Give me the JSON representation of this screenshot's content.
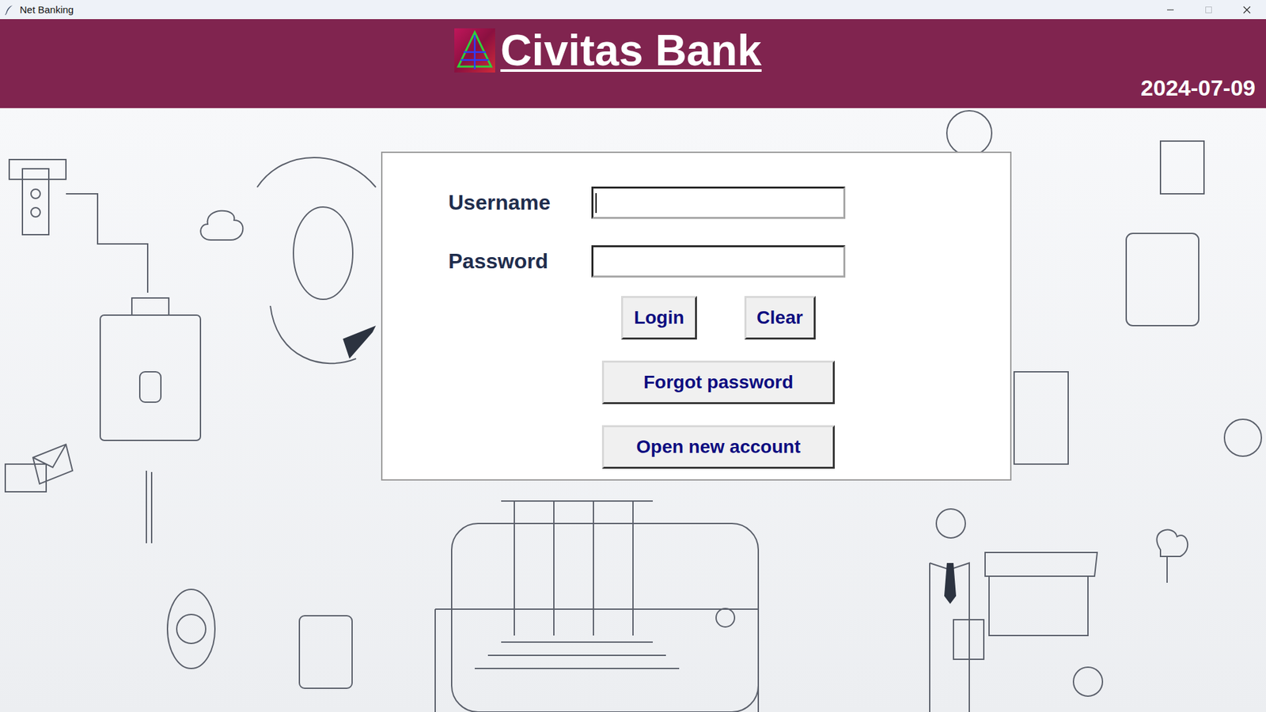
{
  "window": {
    "title": "Net Banking",
    "controls": [
      {
        "name": "minimize",
        "disabled": false
      },
      {
        "name": "maximize",
        "disabled": true
      },
      {
        "name": "close",
        "disabled": false
      }
    ]
  },
  "header": {
    "title": "Civitas Bank",
    "date": "2024-07-09"
  },
  "form": {
    "fields": [
      {
        "label": "Username",
        "value": "",
        "kind": "text",
        "focused": true
      },
      {
        "label": "Password",
        "value": "",
        "kind": "password",
        "focused": false
      }
    ],
    "actions": [
      "Login",
      "Clear"
    ],
    "links": [
      "Forgot password",
      "Open new account"
    ]
  }
}
